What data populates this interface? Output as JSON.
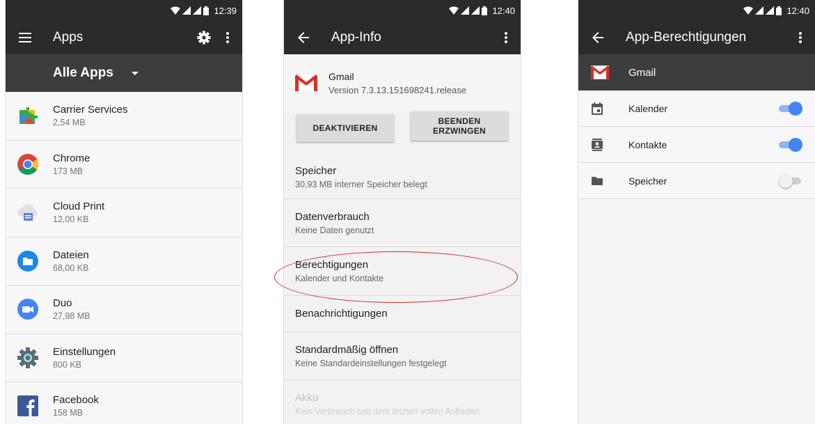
{
  "screen1": {
    "time": "12:39",
    "title": "Apps",
    "filter": "Alle Apps",
    "apps": [
      {
        "name": "Carrier Services",
        "size": "2,54 MB"
      },
      {
        "name": "Chrome",
        "size": "173 MB"
      },
      {
        "name": "Cloud Print",
        "size": "12,00 KB"
      },
      {
        "name": "Dateien",
        "size": "68,00 KB"
      },
      {
        "name": "Duo",
        "size": "27,98 MB"
      },
      {
        "name": "Einstellungen",
        "size": "800 KB"
      },
      {
        "name": "Facebook",
        "size": "158 MB"
      }
    ]
  },
  "screen2": {
    "time": "12:40",
    "title": "App-Info",
    "app_name": "Gmail",
    "version": "Version 7.3.13.151698241.release",
    "btn_disable": "DEAKTIVIEREN",
    "btn_force_stop": "BEENDEN ERZWINGEN",
    "prefs": [
      {
        "title": "Speicher",
        "sub": "30,93 MB interner Speicher belegt"
      },
      {
        "title": "Datenverbrauch",
        "sub": "Keine Daten genutzt"
      },
      {
        "title": "Berechtigungen",
        "sub": "Kalender und Kontakte"
      },
      {
        "title": "Benachrichtigungen"
      },
      {
        "title": "Standardmäßig öffnen",
        "sub": "Keine Standardeinstellungen festgelegt"
      },
      {
        "title": "Akku",
        "sub": "Kein Verbrauch seit dem letzten vollen Aufladen"
      }
    ]
  },
  "screen3": {
    "time": "12:40",
    "title": "App-Berechtigungen",
    "app_name": "Gmail",
    "permissions": [
      {
        "label": "Kalender",
        "enabled": true
      },
      {
        "label": "Kontakte",
        "enabled": true
      },
      {
        "label": "Speicher",
        "enabled": false
      }
    ]
  },
  "colors": {
    "bar_dark": "#2b2b2b",
    "bar_mid": "#3d3d3d",
    "toggle_on": "#4285f4",
    "highlight_ellipse": "#d9232d"
  }
}
